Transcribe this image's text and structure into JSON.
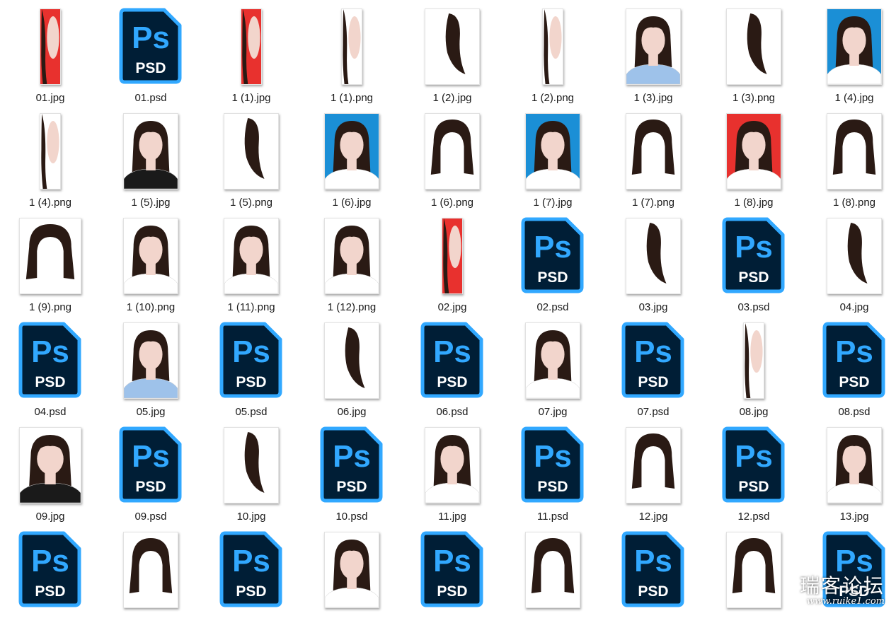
{
  "colors": {
    "psd_body": "#001e36",
    "psd_border": "#31a8ff",
    "psd_text": "#31a8ff",
    "psd_label": "#ffffff",
    "bg_red": "#e8312e",
    "bg_blue": "#1b8fd6",
    "hair": "#2a1a14",
    "skin": "#f2d5cc"
  },
  "psd_icon": {
    "logo": "Ps",
    "label": "PSD"
  },
  "files": [
    {
      "name": "01.jpg",
      "icon": "portrait-photo-icon",
      "kind": "strip",
      "bg": "red"
    },
    {
      "name": "01.psd",
      "icon": "photoshop-file-icon",
      "kind": "psd"
    },
    {
      "name": "1 (1).jpg",
      "icon": "portrait-photo-icon",
      "kind": "strip",
      "bg": "red"
    },
    {
      "name": "1 (1).png",
      "icon": "hair-cutout-icon",
      "kind": "strip",
      "bg": "white"
    },
    {
      "name": "1 (2).jpg",
      "icon": "hair-cutout-icon",
      "kind": "hair",
      "bg": "white"
    },
    {
      "name": "1 (2).png",
      "icon": "hair-cutout-icon",
      "kind": "strip",
      "bg": "white"
    },
    {
      "name": "1 (3).jpg",
      "icon": "portrait-photo-icon",
      "kind": "portrait",
      "bg": "white",
      "shirt": "blue"
    },
    {
      "name": "1 (3).png",
      "icon": "hair-cutout-icon",
      "kind": "hair",
      "bg": "white"
    },
    {
      "name": "1 (4).jpg",
      "icon": "portrait-photo-icon",
      "kind": "portrait",
      "bg": "blue",
      "shirt": "white"
    },
    {
      "name": "1 (4).png",
      "icon": "portrait-photo-icon",
      "kind": "strip",
      "bg": "white"
    },
    {
      "name": "1 (5).jpg",
      "icon": "portrait-photo-icon",
      "kind": "portrait",
      "bg": "white",
      "shirt": "black"
    },
    {
      "name": "1 (5).png",
      "icon": "hair-cutout-icon",
      "kind": "hair",
      "bg": "white"
    },
    {
      "name": "1 (6).jpg",
      "icon": "portrait-photo-icon",
      "kind": "portrait",
      "bg": "blue",
      "shirt": "white"
    },
    {
      "name": "1 (6).png",
      "icon": "hair-cutout-icon",
      "kind": "wig",
      "bg": "white"
    },
    {
      "name": "1 (7).jpg",
      "icon": "portrait-photo-icon",
      "kind": "portrait",
      "bg": "blue",
      "shirt": "white"
    },
    {
      "name": "1 (7).png",
      "icon": "hair-cutout-icon",
      "kind": "wig",
      "bg": "white"
    },
    {
      "name": "1 (8).jpg",
      "icon": "portrait-photo-icon",
      "kind": "portrait",
      "bg": "red",
      "shirt": "white"
    },
    {
      "name": "1 (8).png",
      "icon": "hair-cutout-icon",
      "kind": "wig",
      "bg": "white"
    },
    {
      "name": "1 (9).png",
      "icon": "hair-cutout-icon",
      "kind": "wig",
      "bg": "white"
    },
    {
      "name": "1 (10).png",
      "icon": "portrait-photo-icon",
      "kind": "portrait",
      "bg": "white",
      "shirt": "white"
    },
    {
      "name": "1 (11).png",
      "icon": "portrait-photo-icon",
      "kind": "portrait",
      "bg": "white",
      "shirt": "white"
    },
    {
      "name": "1 (12).png",
      "icon": "portrait-photo-icon",
      "kind": "portrait",
      "bg": "white",
      "shirt": "white"
    },
    {
      "name": "02.jpg",
      "icon": "portrait-photo-icon",
      "kind": "strip",
      "bg": "red"
    },
    {
      "name": "02.psd",
      "icon": "photoshop-file-icon",
      "kind": "psd"
    },
    {
      "name": "03.jpg",
      "icon": "hair-cutout-icon",
      "kind": "hair",
      "bg": "white"
    },
    {
      "name": "03.psd",
      "icon": "photoshop-file-icon",
      "kind": "psd"
    },
    {
      "name": "04.jpg",
      "icon": "hair-cutout-icon",
      "kind": "hair",
      "bg": "white"
    },
    {
      "name": "04.psd",
      "icon": "photoshop-file-icon",
      "kind": "psd"
    },
    {
      "name": "05.jpg",
      "icon": "portrait-photo-icon",
      "kind": "portrait",
      "bg": "white",
      "shirt": "blue"
    },
    {
      "name": "05.psd",
      "icon": "photoshop-file-icon",
      "kind": "psd"
    },
    {
      "name": "06.jpg",
      "icon": "hair-cutout-icon",
      "kind": "hair",
      "bg": "white"
    },
    {
      "name": "06.psd",
      "icon": "photoshop-file-icon",
      "kind": "psd"
    },
    {
      "name": "07.jpg",
      "icon": "portrait-photo-icon",
      "kind": "portrait",
      "bg": "white",
      "shirt": "white"
    },
    {
      "name": "07.psd",
      "icon": "photoshop-file-icon",
      "kind": "psd"
    },
    {
      "name": "08.jpg",
      "icon": "portrait-photo-icon",
      "kind": "strip",
      "bg": "white"
    },
    {
      "name": "08.psd",
      "icon": "photoshop-file-icon",
      "kind": "psd"
    },
    {
      "name": "09.jpg",
      "icon": "portrait-photo-icon",
      "kind": "portrait",
      "bg": "white",
      "shirt": "black"
    },
    {
      "name": "09.psd",
      "icon": "photoshop-file-icon",
      "kind": "psd"
    },
    {
      "name": "10.jpg",
      "icon": "hair-cutout-icon",
      "kind": "hair",
      "bg": "white"
    },
    {
      "name": "10.psd",
      "icon": "photoshop-file-icon",
      "kind": "psd"
    },
    {
      "name": "11.jpg",
      "icon": "portrait-photo-icon",
      "kind": "portrait",
      "bg": "white",
      "shirt": "white"
    },
    {
      "name": "11.psd",
      "icon": "photoshop-file-icon",
      "kind": "psd"
    },
    {
      "name": "12.jpg",
      "icon": "hair-cutout-icon",
      "kind": "wig",
      "bg": "white"
    },
    {
      "name": "12.psd",
      "icon": "photoshop-file-icon",
      "kind": "psd"
    },
    {
      "name": "13.jpg",
      "icon": "portrait-photo-icon",
      "kind": "portrait",
      "bg": "white",
      "shirt": "white"
    },
    {
      "name": "",
      "icon": "photoshop-file-icon",
      "kind": "psd"
    },
    {
      "name": "",
      "icon": "hair-cutout-icon",
      "kind": "wig",
      "bg": "white"
    },
    {
      "name": "",
      "icon": "photoshop-file-icon",
      "kind": "psd"
    },
    {
      "name": "",
      "icon": "portrait-photo-icon",
      "kind": "portrait",
      "bg": "white",
      "shirt": "white"
    },
    {
      "name": "",
      "icon": "photoshop-file-icon",
      "kind": "psd"
    },
    {
      "name": "",
      "icon": "hair-cutout-icon",
      "kind": "wig",
      "bg": "white"
    },
    {
      "name": "",
      "icon": "photoshop-file-icon",
      "kind": "psd"
    },
    {
      "name": "",
      "icon": "hair-cutout-icon",
      "kind": "wig",
      "bg": "white"
    },
    {
      "name": "",
      "icon": "photoshop-file-icon",
      "kind": "psd"
    }
  ],
  "watermark": {
    "main": "瑞客论坛",
    "sub": "www.ruike1.com"
  }
}
